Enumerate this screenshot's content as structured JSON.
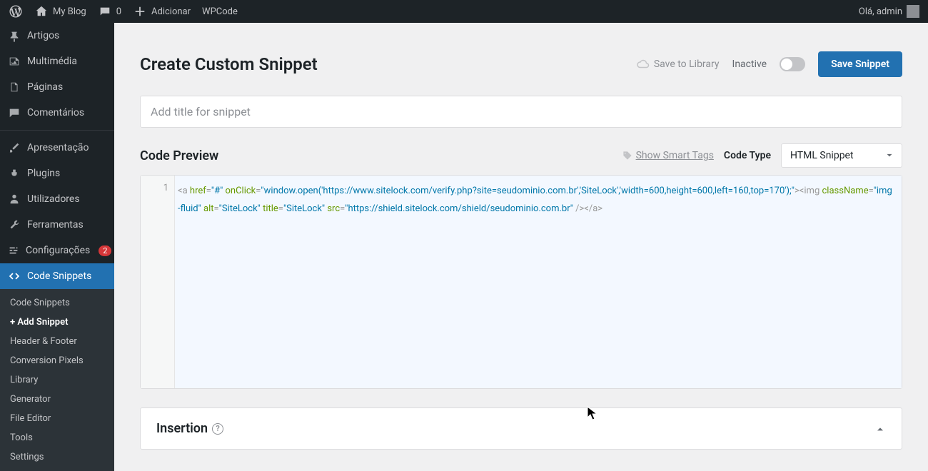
{
  "adminbar": {
    "site": "My Blog",
    "comments": "0",
    "add": "Adicionar",
    "wpcode": "WPCode",
    "greeting": "Olá, admin"
  },
  "sidebar": {
    "items": [
      {
        "icon": "pin",
        "label": "Artigos"
      },
      {
        "icon": "media",
        "label": "Multimédia"
      },
      {
        "icon": "page",
        "label": "Páginas"
      },
      {
        "icon": "comment",
        "label": "Comentários"
      }
    ],
    "items2": [
      {
        "icon": "brush",
        "label": "Apresentação"
      },
      {
        "icon": "plug",
        "label": "Plugins"
      },
      {
        "icon": "user",
        "label": "Utilizadores"
      },
      {
        "icon": "wrench",
        "label": "Ferramentas"
      },
      {
        "icon": "sliders",
        "label": "Configurações",
        "badge": "2"
      }
    ],
    "active": {
      "icon": "code",
      "label": "Code Snippets"
    },
    "submenu": [
      "Code Snippets",
      "+ Add Snippet",
      "Header & Footer",
      "Conversion Pixels",
      "Library",
      "Generator",
      "File Editor",
      "Tools",
      "Settings"
    ],
    "submenu_current": "+ Add Snippet"
  },
  "header": {
    "title": "Create Custom Snippet",
    "save_to_library": "Save to Library",
    "inactive": "Inactive",
    "save_btn": "Save Snippet"
  },
  "title_placeholder": "Add title for snippet",
  "code": {
    "section": "Code Preview",
    "show_tags": "Show Smart Tags",
    "type_label": "Code Type",
    "type_value": "HTML Snippet",
    "line_no": "1",
    "tokens": {
      "a_open": "<a",
      "href_attr": " href",
      "href_val": "\"#\"",
      "onclick_attr": " onClick",
      "onclick_val": "\"window.open('https://www.sitelock.com/verify.php?site=seudominio.com.br','SiteLock','width=600,height=600,left=160,top=170');\"",
      "close1": "><img",
      "class_attr": " className",
      "class_val": "\"img-fluid\"",
      "alt_attr": " alt",
      "alt_val": "\"SiteLock\"",
      "title_attr": " title",
      "title_val": "\"SiteLock\"",
      "src_attr": " src",
      "src_val": "\"https://shield.sitelock.com/shield/seudominio.com.br\"",
      "end": " /></a>"
    }
  },
  "insertion": {
    "title": "Insertion"
  }
}
